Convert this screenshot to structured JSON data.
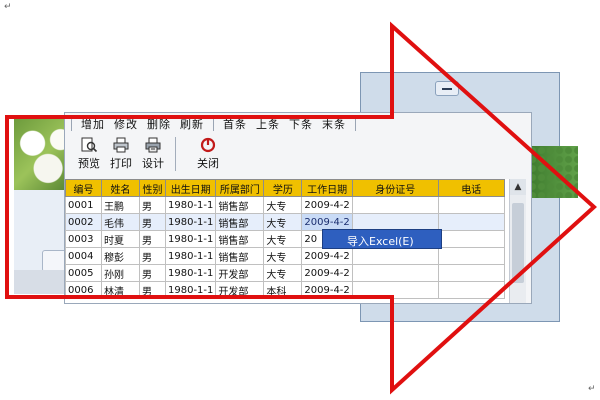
{
  "doc_marks": {
    "top_left": "↵",
    "bottom_right": "↵"
  },
  "menubar": {
    "items": [
      "增加",
      "修改",
      "删除",
      "刷新",
      "首条",
      "上条",
      "下条",
      "末条"
    ]
  },
  "toolbar": {
    "preview_label": "预览",
    "print_label": "打印",
    "design_label": "设计",
    "close_label": "关闭"
  },
  "table": {
    "columns": [
      "编号",
      "姓名",
      "性别",
      "出生日期",
      "所属部门",
      "学历",
      "工作日期",
      "身份证号",
      "电话"
    ],
    "rows": [
      [
        "0001",
        "王鹏",
        "男",
        "1980-1-1",
        "销售部",
        "大专",
        "2009-4-2",
        "",
        ""
      ],
      [
        "0002",
        "毛伟",
        "男",
        "1980-1-1",
        "销售部",
        "大专",
        "2009-4-2",
        "",
        ""
      ],
      [
        "0003",
        "时夏",
        "男",
        "1980-1-1",
        "销售部",
        "大专",
        "20",
        "",
        ""
      ],
      [
        "0004",
        "穆彭",
        "男",
        "1980-1-1",
        "销售部",
        "大专",
        "2009-4-2",
        "",
        ""
      ],
      [
        "0005",
        "孙刚",
        "男",
        "1980-1-1",
        "开发部",
        "大专",
        "2009-4-2",
        "",
        ""
      ],
      [
        "0006",
        "林清",
        "男",
        "1980-1-1",
        "开发部",
        "本科",
        "2009-4-2",
        "",
        ""
      ]
    ],
    "selected_row": 1
  },
  "context_menu": {
    "item": "导入Excel(E)"
  },
  "colors": {
    "arrow": "#e01010",
    "header": "#f0c000",
    "menu_highlight": "#2e5fbf"
  }
}
